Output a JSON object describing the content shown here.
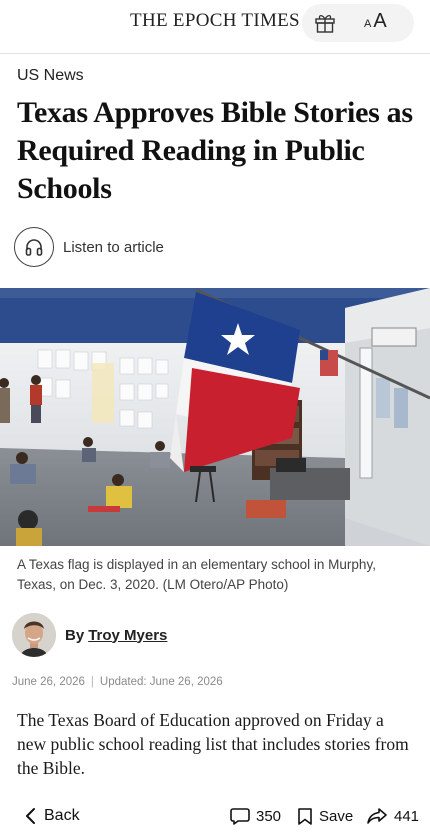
{
  "header": {
    "brand": "THE EPOCH TIMES",
    "gift_icon": "gift-icon",
    "font_small": "A",
    "font_large": "A"
  },
  "article": {
    "section": "US News",
    "headline": "Texas Approves Bible Stories as Required Reading in Public Schools",
    "listen_label": "Listen to article",
    "listen_icon": "headphones-icon",
    "caption": "A Texas flag is displayed in an elementary school in Murphy, Texas, on Dec. 3, 2020. (LM Otero/AP Photo)",
    "author_prefix": "By",
    "author_name": "Troy Myers",
    "published": "June 26, 2026",
    "updated": "Updated: June 26, 2026",
    "date_separator": "|",
    "lede": "The Texas Board of Education approved on Friday a new public school reading list that includes stories from the Bible."
  },
  "toolbar": {
    "back_label": "Back",
    "comments_count": "350",
    "save_label": "Save",
    "share_count": "441"
  },
  "colors": {
    "flag_blue": "#1f3f8f",
    "flag_red": "#c8202f",
    "wall_blue": "#2a4a8c",
    "text": "#1a1a1a",
    "muted": "#8a8a8a"
  }
}
